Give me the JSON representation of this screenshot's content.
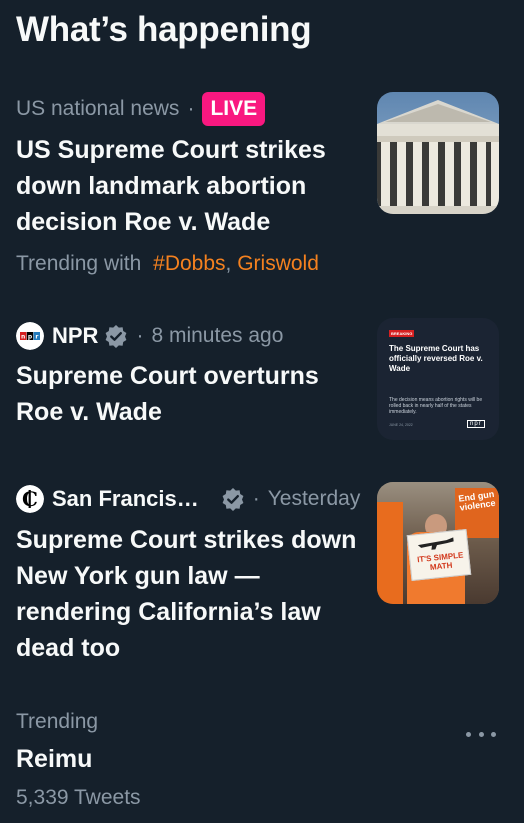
{
  "section": {
    "title": "What’s happening"
  },
  "items": [
    {
      "category": "US national news",
      "separator": "·",
      "live_badge": "LIVE",
      "headline": "US Supreme Court strikes down landmark abortion decision Roe v. Wade",
      "trending_prefix": "Trending with",
      "tags": [
        "#Dobbs",
        "Griswold"
      ],
      "tag_separator": ",",
      "thumb_icon": "supreme-court-building-image"
    },
    {
      "source": "NPR",
      "source_logo_text": "npr",
      "separator": "·",
      "time": "8 minutes ago",
      "headline": "Supreme Court overturns Roe v. Wade",
      "card": {
        "badge": "BREAKING",
        "title": "The Supreme Court has officially reversed Roe v. Wade",
        "body": "The decision means abortion rights will be rolled back in nearly half of the states immediately.",
        "date": "JUNE 24, 2022",
        "brand": "npr"
      }
    },
    {
      "source": "San Francis…",
      "separator": "·",
      "time": "Yesterday",
      "headline": "Supreme Court strikes down New York gun law — rendering California’s law dead too",
      "thumb_sign": [
        "IT'S SIMPLE",
        "MATH"
      ],
      "thumb_bg_sign": [
        "End gun",
        "violence"
      ]
    },
    {
      "label": "Trending",
      "title": "Reimu",
      "count": "5,339 Tweets"
    }
  ],
  "colors": {
    "background": "#15202b",
    "accent": "#f4811f",
    "live": "#f91880",
    "muted": "#8b98a5"
  }
}
